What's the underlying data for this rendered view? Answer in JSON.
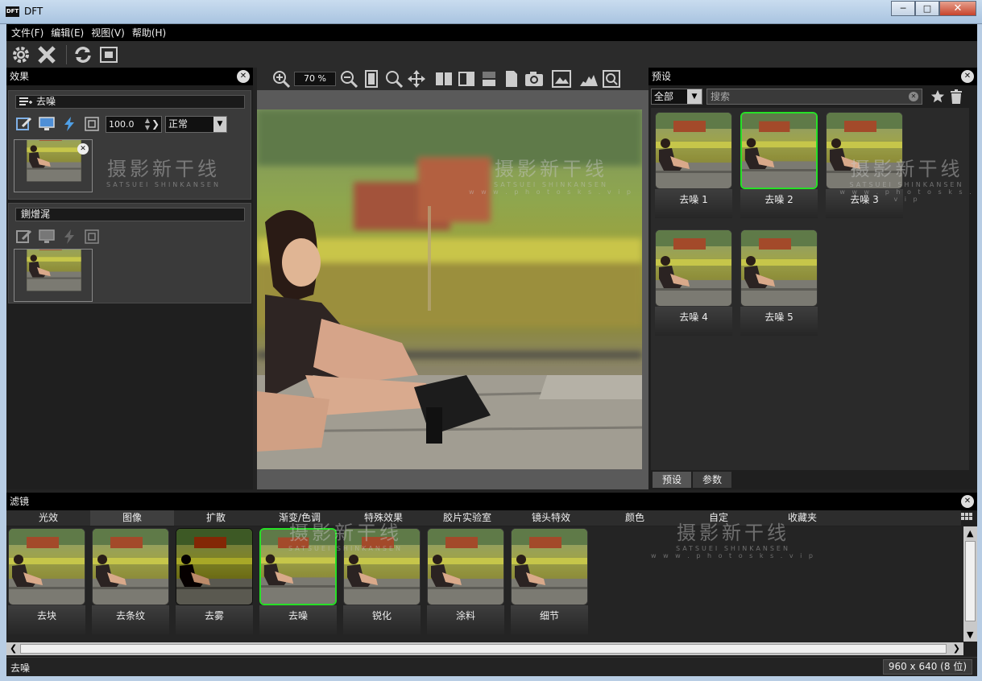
{
  "window": {
    "title": "DFT",
    "logo": "DFT"
  },
  "menu": [
    "文件(F)",
    "编辑(E)",
    "视图(V)",
    "帮助(H)"
  ],
  "effects_panel": {
    "title": "效果",
    "blocks": [
      {
        "name": "去噪",
        "value": "100.0",
        "blend_mode": "正常"
      },
      {
        "name": "鍘熷浘"
      }
    ]
  },
  "viewer": {
    "zoom": "70 %"
  },
  "presets_panel": {
    "title": "预设",
    "filter": "全部",
    "search_placeholder": "搜索",
    "items": [
      {
        "label": "去噪 1",
        "selected": false
      },
      {
        "label": "去噪 2",
        "selected": true
      },
      {
        "label": "去噪 3",
        "selected": false
      },
      {
        "label": "去噪 4",
        "selected": false
      },
      {
        "label": "去噪 5",
        "selected": false
      }
    ],
    "tabs": [
      "预设",
      "参数"
    ]
  },
  "filters_panel": {
    "title": "滤镜",
    "tabs": [
      "光效",
      "图像",
      "扩散",
      "渐变/色调",
      "特殊效果",
      "胶片实验室",
      "镜头特效",
      "颜色",
      "自定",
      "收藏夹"
    ],
    "active_tab": "图像",
    "items": [
      {
        "label": "去块"
      },
      {
        "label": "去条纹"
      },
      {
        "label": "去雾"
      },
      {
        "label": "去噪",
        "selected": true
      },
      {
        "label": "锐化"
      },
      {
        "label": "涂料"
      },
      {
        "label": "细节"
      }
    ]
  },
  "status": {
    "current": "去噪",
    "image_info": "960 x 640 (8 位)"
  },
  "watermark": {
    "cn": "摄影新干线",
    "en": "SATSUEI SHINKANSEN",
    "url": "w w w . p h o t o s k s . v i p"
  },
  "colors": {
    "selected_border": "#27e027",
    "panel_bg": "#1f1f1f",
    "header_bg": "#000000"
  }
}
